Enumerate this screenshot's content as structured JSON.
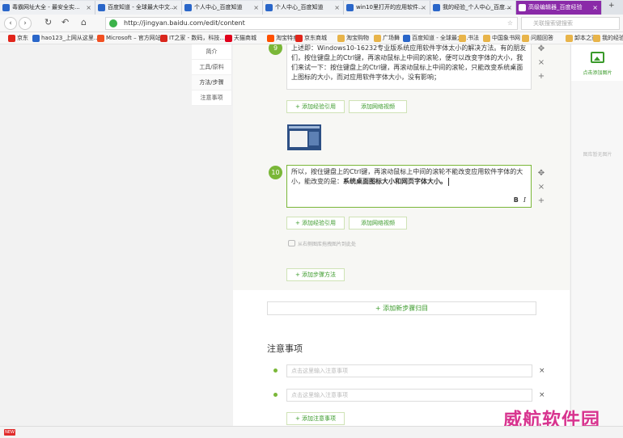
{
  "tabs": [
    {
      "label": "毒霸网址大全 - 最安全实...",
      "active": false
    },
    {
      "label": "百度知道 - 全球最大中文...",
      "active": false
    },
    {
      "label": "个人中心_百度知道",
      "active": false
    },
    {
      "label": "个人中心_百度知道",
      "active": false
    },
    {
      "label": "win10里打开的应用软件...",
      "active": false
    },
    {
      "label": "我的经验_个人中心_百度...",
      "active": false
    },
    {
      "label": "高级编辑器_百度经验",
      "active": true
    }
  ],
  "address": {
    "url": "http://jingyan.baidu.com/edit/content",
    "search_placeholder": "关联搜索键搜索",
    "back": "‹",
    "forward": "›",
    "refresh": "↻",
    "undo": "↶",
    "home": "⌂"
  },
  "bookmarks": [
    {
      "label": "京东",
      "color": "#e1251b"
    },
    {
      "label": "hao123_上网从这里...",
      "color": "#2a66c9"
    },
    {
      "label": "Microsoft – 官方网站",
      "color": "#f25022"
    },
    {
      "label": "IT之家 - 数码，科技...",
      "color": "#d9261c"
    },
    {
      "label": "天猫商城",
      "color": "#e0001b"
    },
    {
      "label": "淘宝特卖",
      "color": "#ff5000"
    },
    {
      "label": "京东商城",
      "color": "#e1251b"
    },
    {
      "label": "淘宝购物",
      "color": "#e8b44a"
    },
    {
      "label": "广场舞",
      "color": "#e8b44a"
    },
    {
      "label": "百度知道 - 全球最大...",
      "color": "#2a66c9"
    },
    {
      "label": "书法",
      "color": "#e8b44a"
    },
    {
      "label": "中国象书网",
      "color": "#e8b44a"
    },
    {
      "label": "问题回答",
      "color": "#e8b44a"
    },
    {
      "label": "卸本之家",
      "color": "#e8b44a"
    },
    {
      "label": "我的经验",
      "color": "#e8b44a"
    }
  ],
  "leftnav": [
    "简介",
    "工具/原料",
    "方法/步骤",
    "注意事项"
  ],
  "step9": {
    "number": "9",
    "text": "上述即：Windows10-16232专业版系统应用软件字体太小的解决方法。有的朋友们，按住键盘上的Ctrl键，再滚动鼠标上中间的滚轮，便可以改变字体的大小，我们来试一下：按住键盘上的Ctrl键，再滚动鼠标上中间的滚轮，只能改变系统桌面上图标的大小，而对应用软件字体大小，没有影响；"
  },
  "step10": {
    "number": "10",
    "text": "所以，按住键盘上的Ctrl键，再滚动鼠标上中间的滚轮不能改变应用软件字体的大小，能改变的是：",
    "bold": "系统桌面图标大小和网页字体大小。",
    "fmt_bold": "B",
    "fmt_italic": "I"
  },
  "buttons": {
    "add_ref": "+ 添加经验引用",
    "add_video": "添加网络视频",
    "add_method": "+ 添加步骤方法",
    "add_group": "+ 添加新步骤归目",
    "add_note": "+ 添加注意事项"
  },
  "hint_text": "从右侧图库拖拽图片到此处",
  "controls": {
    "move": "✥",
    "close": "×",
    "add": "+"
  },
  "notes": {
    "title": "注意事项",
    "placeholder": "点击这里输入注意事项",
    "delete": "×"
  },
  "rightpanel": {
    "add_image": "点击添加图片",
    "no_image": "图库暂无图片"
  },
  "watermark": "威航软件园",
  "status": {
    "badge": "NEW"
  }
}
